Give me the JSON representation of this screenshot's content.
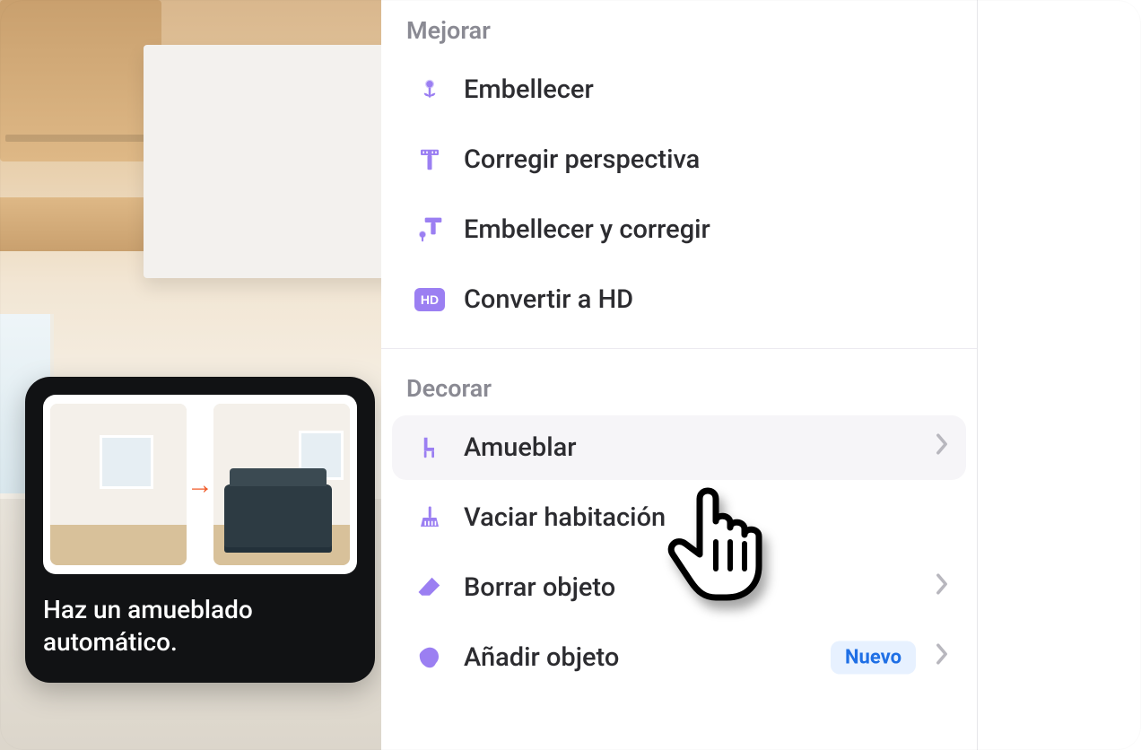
{
  "tooltip": {
    "text": "Haz un amueblado automático.",
    "arrow_icon": "arrow-right"
  },
  "panel": {
    "section_improve_title": "Mejorar",
    "section_decorate_title": "Decorar",
    "items_improve": [
      {
        "label": "Embellecer",
        "icon": "flower-icon"
      },
      {
        "label": "Corregir perspectiva",
        "icon": "ruler-t-icon"
      },
      {
        "label": "Embellecer y corregir",
        "icon": "flower-ruler-icon"
      },
      {
        "label": "Convertir a HD",
        "icon": "hd-icon"
      }
    ],
    "items_decorate": [
      {
        "label": "Amueblar",
        "icon": "chair-icon",
        "hovered": true,
        "chevron": true
      },
      {
        "label": "Vaciar habitación",
        "icon": "broom-icon"
      },
      {
        "label": "Borrar objeto",
        "icon": "eraser-icon",
        "chevron": true
      },
      {
        "label": "Añadir objeto",
        "icon": "blob-icon",
        "chevron": true,
        "badge": "Nuevo"
      }
    ]
  }
}
